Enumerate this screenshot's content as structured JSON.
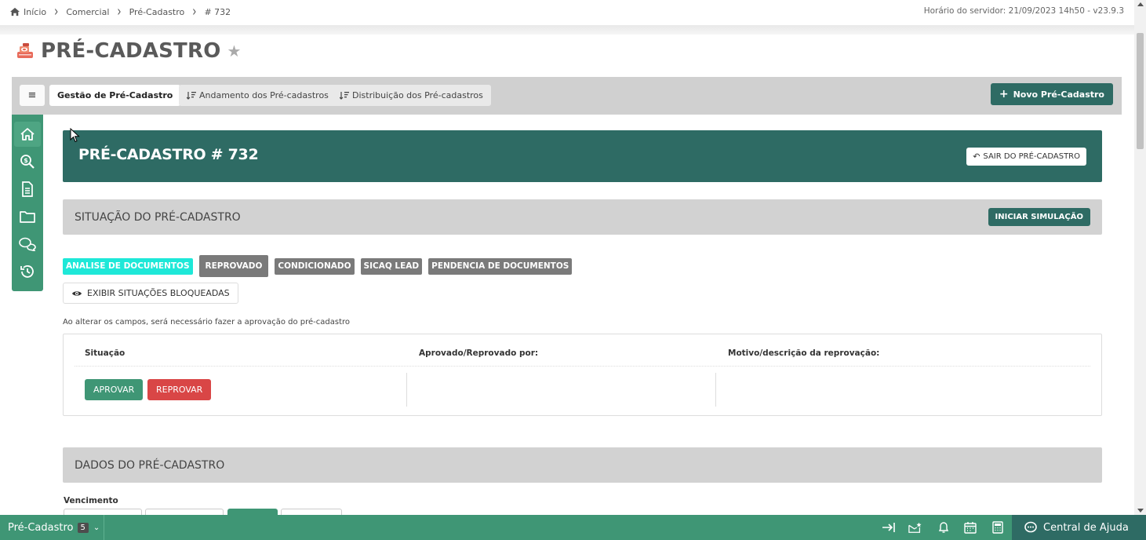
{
  "breadcrumb": {
    "items": [
      "Início",
      "Comercial",
      "Pré-Cadastro",
      "# 732"
    ]
  },
  "server_time": "Horário do servidor: 21/09/2023 14h50 - v23.9.3",
  "page": {
    "title": "PRÉ-CADASTRO",
    "icon": "cash-register-icon"
  },
  "tabs": {
    "items": [
      {
        "label": "Gestão de Pré-Cadastro",
        "active": true
      },
      {
        "label": "Andamento dos Pré-cadastros",
        "active": false
      },
      {
        "label": "Distribuição dos Pré-cadastros",
        "active": false
      }
    ],
    "new_button": "Novo Pré-Cadastro"
  },
  "rail": [
    "home-icon",
    "search-dollar-icon",
    "document-icon",
    "folder-icon",
    "chat-icon",
    "history-icon"
  ],
  "header": {
    "title": "PRÉ-CADASTRO # 732",
    "exit_button": "SAIR DO PRÉ-CADASTRO"
  },
  "situation": {
    "title": "SITUAÇÃO DO PRÉ-CADASTRO",
    "sim_button": "INICIAR SIMULAÇÃO",
    "badges": [
      "ANALISE DE DOCUMENTOS",
      "REPROVADO",
      "CONDICIONADO",
      "SICAQ LEAD",
      "PENDENCIA DE DOCUMENTOS"
    ],
    "show_blocked": "EXIBIR SITUAÇÕES BLOQUEADAS",
    "notice": "Ao alterar os campos, será necessário fazer a aprovação do pré-cadastro"
  },
  "approval_table": {
    "columns": [
      "Situação",
      "Aprovado/Reprovado por:",
      "Motivo/descrição da reprovação:"
    ],
    "approve": "APROVAR",
    "reject": "REPROVAR"
  },
  "data_section": {
    "title": "DADOS DO PRÉ-CADASTRO",
    "vencimento_label": "Vencimento"
  },
  "footer": {
    "tab_label": "Pré-Cadastro",
    "tab_count": "5",
    "help": "Central de Ajuda"
  },
  "colors": {
    "primary_dark": "#2e6b64",
    "primary": "#3f9675",
    "danger": "#d94646",
    "cyan_badge": "#1ee8d8"
  }
}
